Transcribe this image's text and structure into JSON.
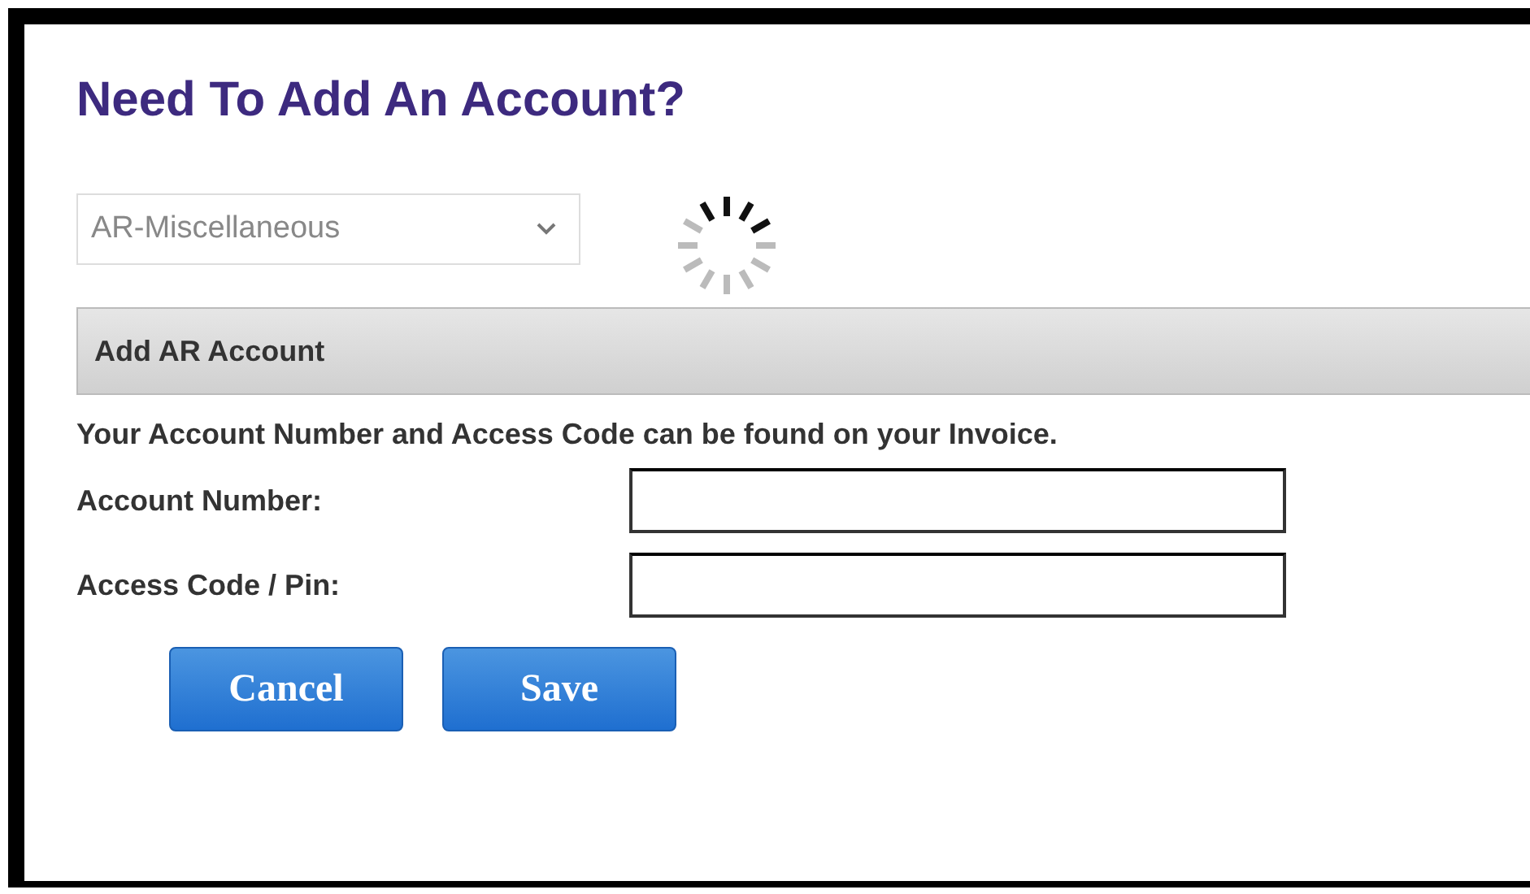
{
  "title": "Need To Add An Account?",
  "account_type": {
    "value": "AR-Miscellaneous",
    "disabled": true
  },
  "loading": true,
  "section": {
    "heading": "Add AR Account"
  },
  "instructions": "Your Account Number and Access Code can be found on your Invoice.",
  "fields": [
    {
      "label": "Account Number:"
    },
    {
      "label": "Access Code / Pin:"
    }
  ],
  "buttons": [
    "Cancel",
    "Save"
  ]
}
